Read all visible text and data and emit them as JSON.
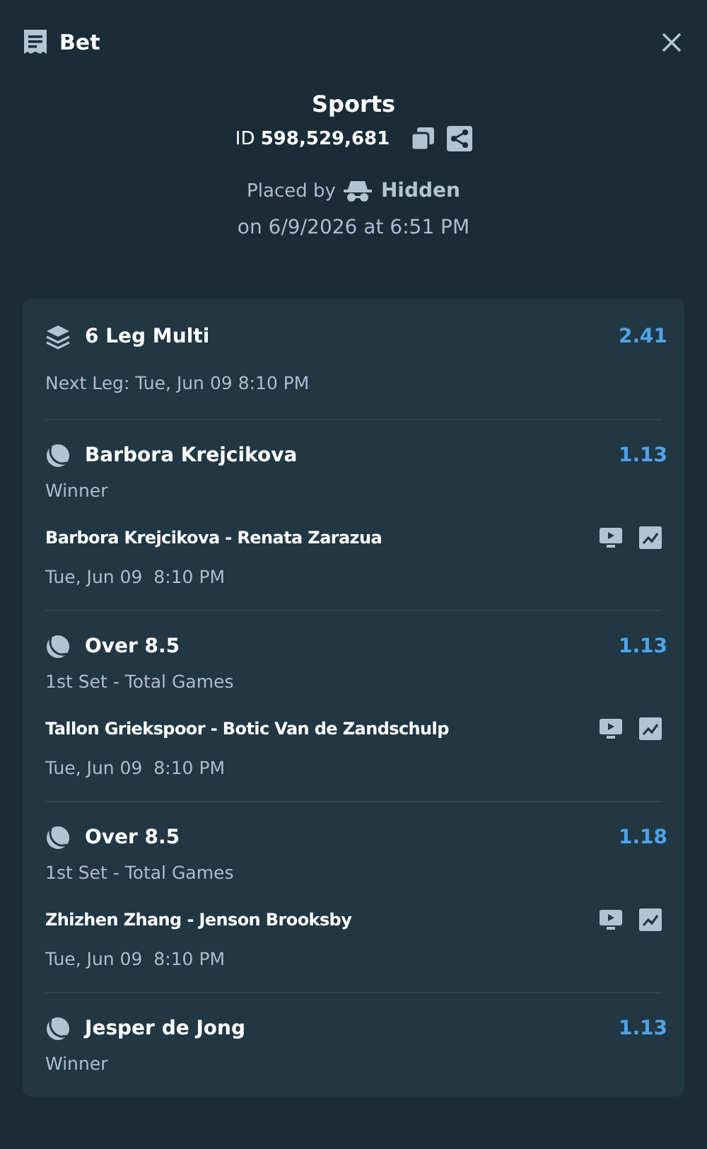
{
  "header": {
    "title": "Bet"
  },
  "bet": {
    "category": "Sports",
    "id_label": "ID",
    "id": "598,529,681",
    "placed_by_label": "Placed by",
    "placed_by": "Hidden",
    "placed_on": "on 6/9/2026 at 6:51 PM"
  },
  "multi": {
    "title": "6 Leg Multi",
    "odds": "2.41",
    "next_leg": "Next Leg: Tue, Jun 09 8:10 PM"
  },
  "legs": [
    {
      "selection": "Barbora Krejcikova",
      "odds": "1.13",
      "market": "Winner",
      "match": "Barbora Krejcikova - Renata Zarazua",
      "time": "Tue, Jun 09  8:10 PM"
    },
    {
      "selection": "Over 8.5",
      "odds": "1.13",
      "market": "1st Set - Total Games",
      "match": "Tallon Griekspoor - Botic Van de Zandschulp",
      "time": "Tue, Jun 09  8:10 PM"
    },
    {
      "selection": "Over 8.5",
      "odds": "1.18",
      "market": "1st Set - Total Games",
      "match": "Zhizhen Zhang - Jenson Brooksby",
      "time": "Tue, Jun 09  8:10 PM"
    },
    {
      "selection": "Jesper de Jong",
      "odds": "1.13",
      "market": "Winner"
    }
  ]
}
